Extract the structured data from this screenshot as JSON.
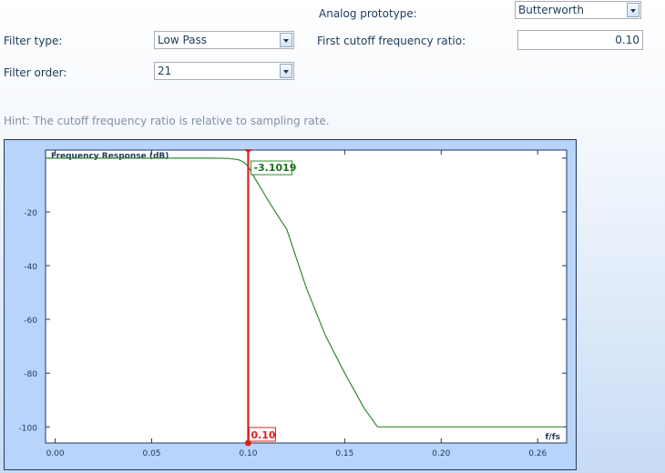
{
  "form": {
    "analog_prototype_label": "Analog prototype:",
    "analog_prototype_value": "Butterworth",
    "filter_type_label": "Filter type:",
    "filter_type_value": "Low Pass",
    "first_cutoff_label": "First cutoff frequency ratio:",
    "first_cutoff_value": "0.10",
    "filter_order_label": "Filter order:",
    "filter_order_value": "21"
  },
  "hint": "Hint: The cutoff frequency ratio is relative to sampling rate.",
  "colors": {
    "curve": "#2e8b2e",
    "cursor": "#e02020",
    "accent": "#1e395b"
  },
  "chart_data": {
    "type": "line",
    "title": "Frequency Response (dB)",
    "xlabel": "f/fs",
    "ylabel": "",
    "xlim": [
      -0.005,
      0.265
    ],
    "ylim": [
      -106,
      3
    ],
    "x_ticks": [
      0.0,
      0.05,
      0.1,
      0.15,
      0.2,
      0.25
    ],
    "x_tick_labels": [
      "0.00",
      "0.05",
      "0.10",
      "0.15",
      "0.20",
      "0.26"
    ],
    "y_ticks": [
      -20,
      -40,
      -60,
      -80,
      -100
    ],
    "y_tick_labels": [
      "-20",
      "-40",
      "-60",
      "-80",
      "-100"
    ],
    "grid": false,
    "series": [
      {
        "x": [
          -0.005,
          0.0,
          0.05,
          0.08,
          0.09,
          0.095,
          0.098,
          0.1,
          0.103,
          0.106,
          0.11,
          0.115,
          0.12,
          0.13,
          0.14,
          0.15,
          0.16,
          0.167,
          0.2,
          0.25,
          0.26,
          0.2625
        ],
        "y": [
          0,
          0,
          0,
          0,
          -0.1,
          -0.6,
          -1.6,
          -3.1,
          -7.0,
          -10.5,
          -15.3,
          -21,
          -26.5,
          -48,
          -66,
          -80,
          -93,
          -100,
          -100,
          -100,
          -100,
          -100
        ]
      }
    ],
    "cursor": {
      "x": 0.1,
      "x_label": "0.10",
      "y_label": "-3.1019"
    }
  }
}
